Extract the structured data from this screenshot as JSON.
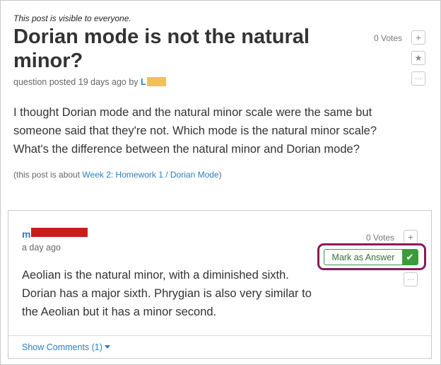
{
  "post": {
    "visibility": "This post is visible to everyone.",
    "title": "Dorian mode is not the natural minor?",
    "posted_prefix": "question posted 19 days ago by",
    "author_initial": "L",
    "body": "I thought Dorian mode and the natural minor scale were the same but someone said that they're not. Which mode is the natural minor scale? What's the difference between the natural minor and Dorian mode?",
    "about_prefix": "(this post is about",
    "about_link": "Week 2: Homework 1 / Dorian Mode",
    "about_suffix": ")",
    "votes": "0 Votes",
    "plus_icon": "+",
    "star_icon": "★",
    "more_icon": "···"
  },
  "answer": {
    "user_initial": "m",
    "date": "a day ago",
    "body": "Aeolian is the natural minor, with a diminished sixth. Dorian has a major sixth. Phrygian is also very similar to the Aeolian but it has a minor second.",
    "votes": "0 Votes",
    "plus_icon": "+",
    "more_icon": "···",
    "mark_label": "Mark as Answer",
    "check_icon": "✔",
    "show_comments": "Show Comments (1)"
  },
  "colors": {
    "link": "#2a7fc1",
    "highlight": "#8a1a5b",
    "accept": "#3c9a3c",
    "redaction_author": "#f0c05a",
    "redaction_answer_user": "#c81d1d"
  }
}
